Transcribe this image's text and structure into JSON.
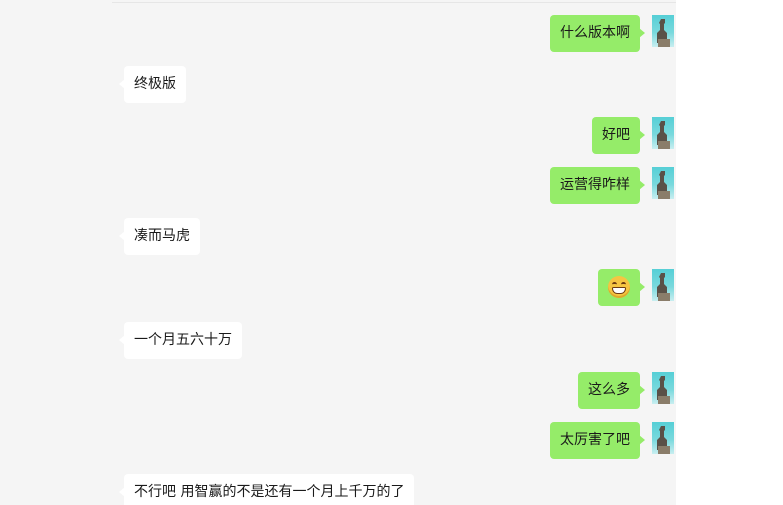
{
  "chat": {
    "messages": [
      {
        "side": "out",
        "text": "什么版本啊"
      },
      {
        "side": "in",
        "text": "终极版"
      },
      {
        "side": "out",
        "text": "好吧"
      },
      {
        "side": "out",
        "text": "运营得咋样"
      },
      {
        "side": "in",
        "text": "凑而马虎"
      },
      {
        "side": "out",
        "text": "",
        "emoji": "grinning-face-emoji"
      },
      {
        "side": "in",
        "text": "一个月五六十万"
      },
      {
        "side": "out",
        "text": "这么多"
      },
      {
        "side": "out",
        "text": "太厉害了吧"
      },
      {
        "side": "in",
        "text": "不行吧 用智赢的不是还有一个月上千万的了"
      }
    ]
  },
  "colors": {
    "outgoing_bubble": "#95ec69",
    "incoming_bubble": "#ffffff",
    "chat_background": "#f5f5f5"
  },
  "icons": {
    "avatar": "user-avatar-icon",
    "emoji": "grinning-face-emoji"
  }
}
